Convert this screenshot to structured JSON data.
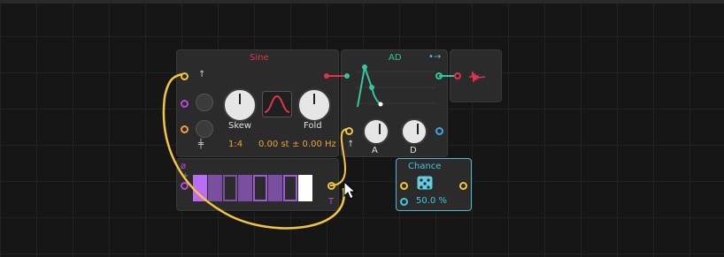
{
  "modules": {
    "sine": {
      "title": "Sine",
      "skew": "Skew",
      "fold": "Fold",
      "ratio": "1:4",
      "st": "0.00 st",
      "hz": "± 0.00 Hz"
    },
    "ad": {
      "title": "AD",
      "a": "A",
      "d": "D"
    },
    "seq": {
      "t": "T"
    },
    "chance": {
      "title": "Chance",
      "value": "50.0 %"
    }
  },
  "colors": {
    "sine_title": "#e3334b",
    "ad_title": "#33c7a1",
    "chance_title": "#43c6e3",
    "port": "#f4c63d"
  }
}
